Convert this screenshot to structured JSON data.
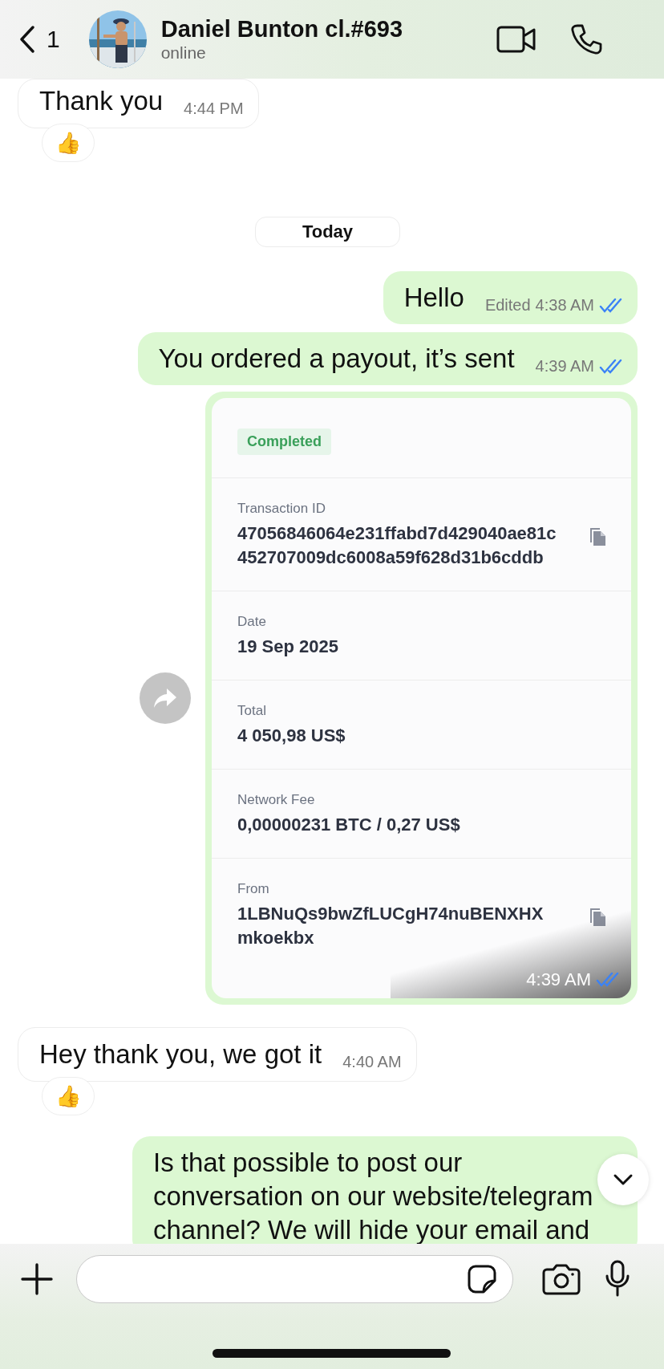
{
  "header": {
    "back_count": "1",
    "contact_name": "Daniel Bunton cl.#693",
    "status": "online"
  },
  "messages": [
    {
      "kind": "incoming",
      "text": "Thank you",
      "time": "4:44 PM",
      "reaction": "👍"
    },
    {
      "kind": "date",
      "text": "Today"
    },
    {
      "kind": "outgoing",
      "text": "Hello",
      "edited": "Edited",
      "time": "4:38 AM",
      "read": true
    },
    {
      "kind": "outgoing",
      "text": "You ordered a payout, it’s sent",
      "time": "4:39 AM",
      "read": true
    },
    {
      "kind": "payment",
      "status": "Completed",
      "fields": [
        {
          "label": "Transaction ID",
          "value": "47056846064e231ffabd7d429040ae81c452707009dc6008a59f628d31b6cddb",
          "copy": true
        },
        {
          "label": "Date",
          "value": "19 Sep 2025"
        },
        {
          "label": "Total",
          "value": "4 050,98 US$"
        },
        {
          "label": "Network Fee",
          "value": "0,00000231 BTC / 0,27 US$"
        },
        {
          "label": "From",
          "value": "1LBNuQs9bwZfLUCgH74nuBENXHXmkoekbx",
          "copy": true
        }
      ],
      "time": "4:39 AM",
      "read": true
    },
    {
      "kind": "incoming",
      "text": "Hey thank you, we got it",
      "time": "4:40 AM",
      "reaction": "👍"
    },
    {
      "kind": "outgoing",
      "text": "Is that possible to post our conversation on our website/telegram channel? We will hide your email and"
    }
  ]
}
